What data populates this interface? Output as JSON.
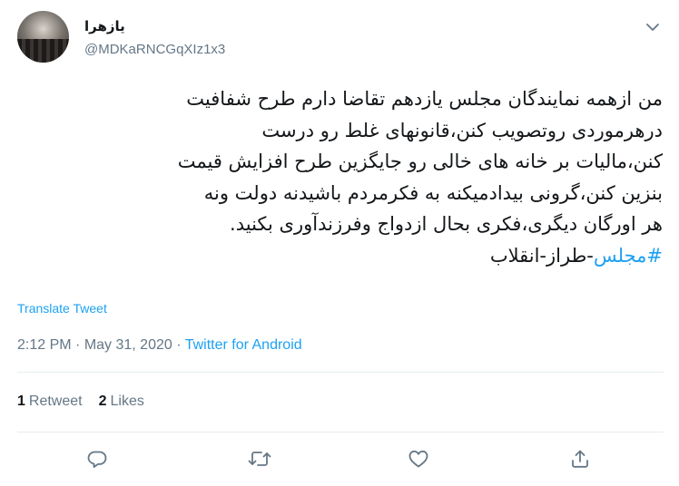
{
  "user": {
    "display_name": "یازهرا",
    "handle": "@MDKaRNCGqXIz1x3"
  },
  "tweet": {
    "lines": [
      "من ازهمه نمایندگان مجلس یازدهم تقاضا دارم طرح شفافیت",
      "درهرموردی روتصویب کنن،قانونهای غلط رو درست",
      "کنن،مالیات بر خانه های خالی رو جایگزین طرح افزایش قیمت",
      "بنزین کنن،گرونی بیدادمیکنه به فکرمردم باشیدنه دولت ونه",
      "هر اورگان دیگری،فکری بحال ازدواج وفرزندآوری بکنید."
    ],
    "hashtag": "#مجلس",
    "hashtag_rest": "-طراز-انقلاب"
  },
  "translate_label": "Translate Tweet",
  "meta": {
    "time": "2:12 PM",
    "separator": " · ",
    "date": "May 31, 2020",
    "source": "Twitter for Android"
  },
  "stats": {
    "retweets_count": "1",
    "retweets_label": "Retweet",
    "likes_count": "2",
    "likes_label": "Likes"
  },
  "icons": {
    "caret": "chevron-down-icon",
    "reply": "reply-icon",
    "retweet": "retweet-icon",
    "like": "heart-icon",
    "share": "share-icon"
  },
  "colors": {
    "accent": "#1da1f2",
    "muted": "#657786",
    "text": "#14171a",
    "divider": "#e6ecf0"
  }
}
